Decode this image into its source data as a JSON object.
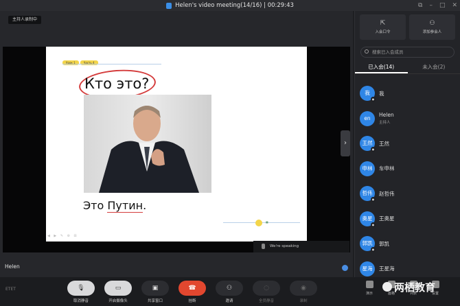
{
  "window": {
    "title": "Helen's video meeting(14/16) | 00:29:43"
  },
  "main": {
    "host_tag": "主持人录制中",
    "speaker_name": "Helen",
    "speaking_text": "We're speaking"
  },
  "slide": {
    "tags": [
      "Урок 1",
      "Часть 4"
    ],
    "question": "Кто это?",
    "answer_prefix": "Это ",
    "answer_name": "Путин",
    "answer_suffix": "."
  },
  "sidebar": {
    "actions": [
      {
        "label": "入会口令",
        "icon": "share-icon"
      },
      {
        "label": "添加参会人",
        "icon": "add-user-icon"
      }
    ],
    "search_placeholder": "搜索已入会成员",
    "tabs": {
      "joined": "已入会(14)",
      "not_joined": "未入会(2)"
    },
    "members": [
      {
        "avatar": "我",
        "name": "我",
        "role": ""
      },
      {
        "avatar": "en",
        "name": "Helen",
        "role": "主持人"
      },
      {
        "avatar": "王然",
        "name": "王然",
        "role": ""
      },
      {
        "avatar": "申林",
        "name": "车申林",
        "role": ""
      },
      {
        "avatar": "哲伟",
        "name": "赵哲伟",
        "role": ""
      },
      {
        "avatar": "奥星",
        "name": "王奥星",
        "role": ""
      },
      {
        "avatar": "郭凯",
        "name": "郭凯",
        "role": ""
      },
      {
        "avatar": "星海",
        "name": "王星海",
        "role": ""
      }
    ]
  },
  "toolbar": {
    "brand": "ETET",
    "buttons": [
      {
        "label": "取消静音",
        "icon": "mic-muted-icon"
      },
      {
        "label": "开启摄像头",
        "icon": "camera-off-icon"
      },
      {
        "label": "共享窗口",
        "icon": "share-window-icon"
      },
      {
        "label": "挂断",
        "icon": "hangup-icon"
      },
      {
        "label": "邀请",
        "icon": "invite-icon"
      },
      {
        "label": "全员静音",
        "icon": "mute-all-icon"
      },
      {
        "label": "录制",
        "icon": "record-icon"
      }
    ],
    "right_buttons": [
      {
        "label": "演示"
      },
      {
        "label": "画格"
      },
      {
        "label": "列表"
      },
      {
        "label": "设置"
      }
    ],
    "watermark": "两栖教育"
  },
  "colors": {
    "accent_blue": "#2f86e6",
    "hangup_red": "#e2472f",
    "highlight_yellow": "#f3d54a",
    "ring_red": "#d43b3b"
  }
}
